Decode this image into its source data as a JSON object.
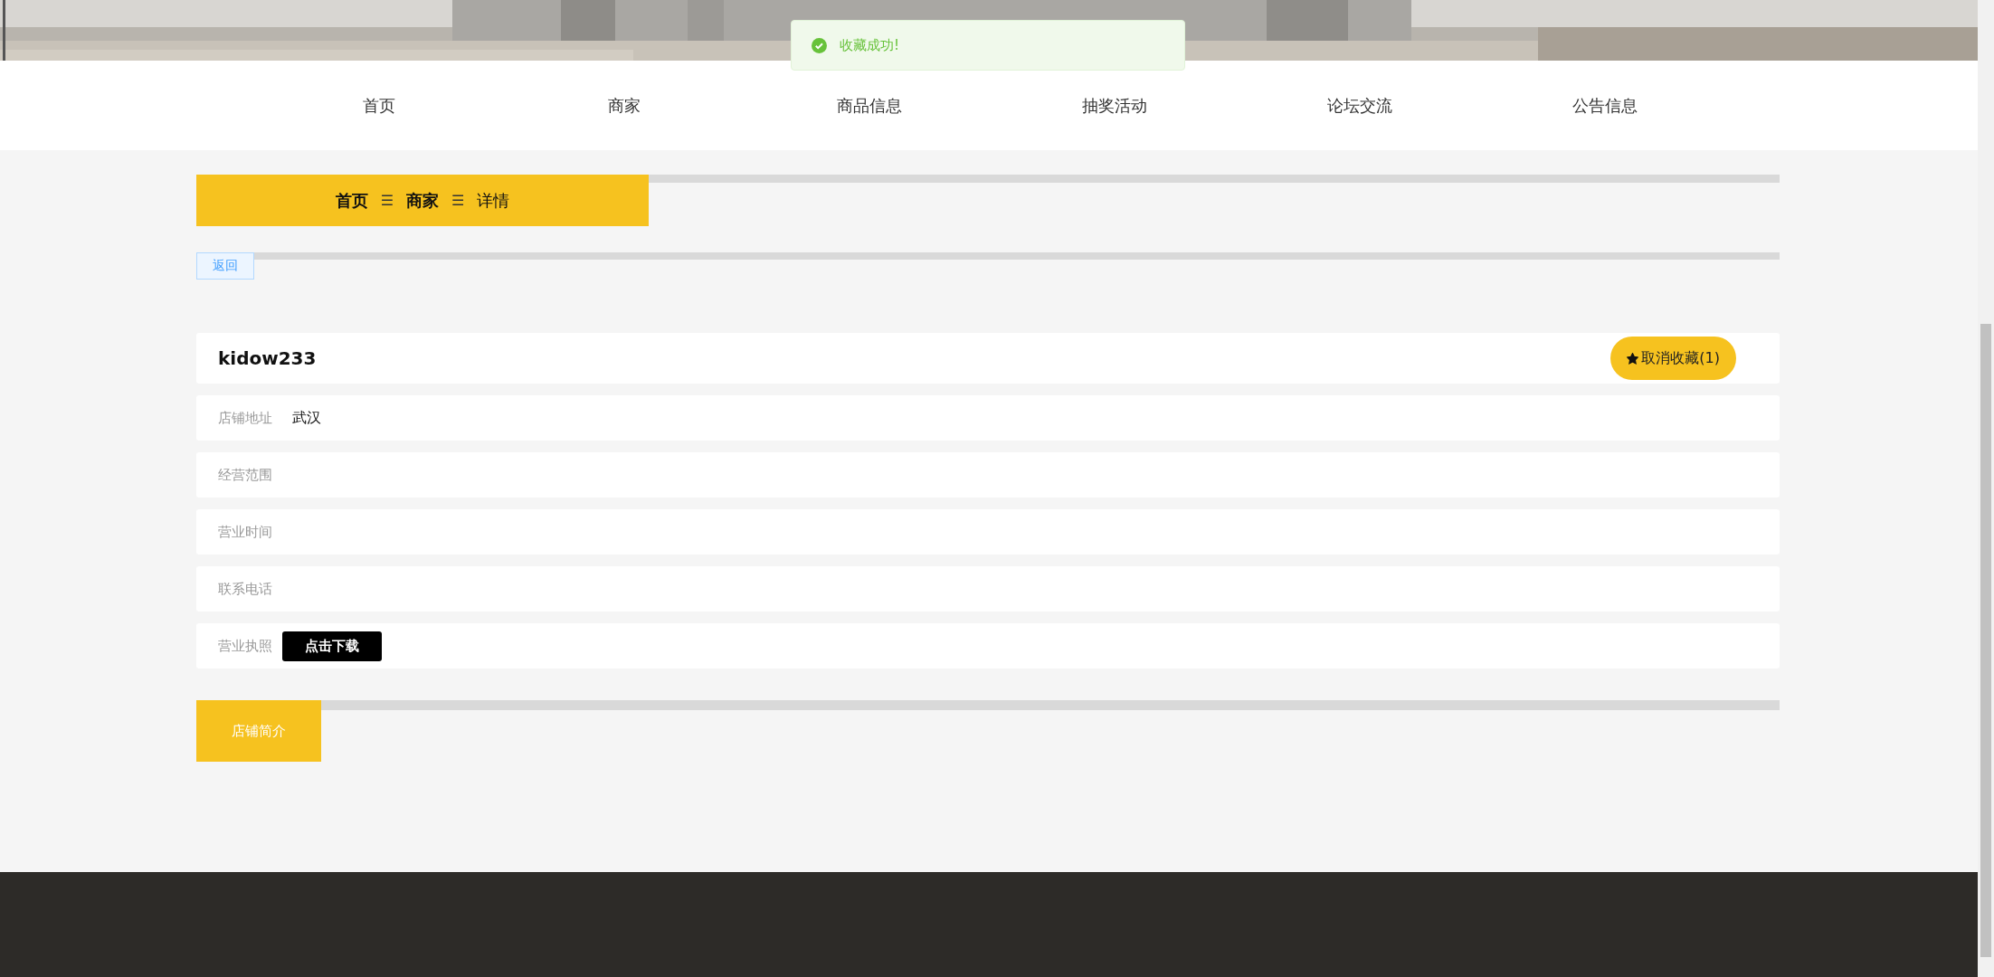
{
  "toast": {
    "message": "收藏成功!"
  },
  "nav": [
    {
      "label": "首页"
    },
    {
      "label": "商家"
    },
    {
      "label": "商品信息"
    },
    {
      "label": "抽奖活动"
    },
    {
      "label": "论坛交流"
    },
    {
      "label": "公告信息"
    }
  ],
  "breadcrumb": [
    {
      "label": "首页",
      "current": false
    },
    {
      "label": "商家",
      "current": false
    },
    {
      "label": "详情",
      "current": true
    }
  ],
  "separator": "☰",
  "back_button": "返回",
  "shop": {
    "name": "kidow233",
    "favorite_button": "取消收藏(1)",
    "favorited": true
  },
  "fields": [
    {
      "kind": "text",
      "label": "店铺地址",
      "value": "武汉"
    },
    {
      "kind": "text",
      "label": "经营范围"
    },
    {
      "kind": "text",
      "label": "营业时间"
    },
    {
      "kind": "text",
      "label": "联系电话"
    },
    {
      "kind": "download",
      "label": "营业执照",
      "button": "点击下载"
    }
  ],
  "intro_title": "店铺简介"
}
